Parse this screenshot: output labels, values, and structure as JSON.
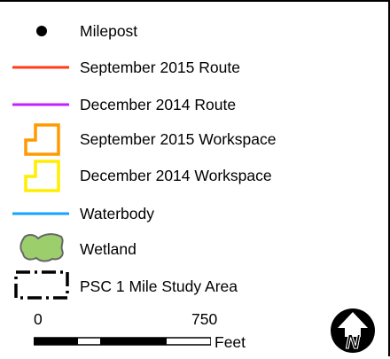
{
  "legend": {
    "items": [
      {
        "label": "Milepost",
        "symbol": "point",
        "color": "#000000"
      },
      {
        "label": "September 2015 Route",
        "symbol": "line",
        "color": "#ff3b1a"
      },
      {
        "label": "December 2014 Route",
        "symbol": "line",
        "color": "#c41fff"
      },
      {
        "label": "September 2015 Workspace",
        "symbol": "polygon-outline",
        "color": "#ff9a00"
      },
      {
        "label": "December 2014 Workspace",
        "symbol": "polygon-outline",
        "color": "#ffee00"
      },
      {
        "label": "Waterbody",
        "symbol": "line",
        "color": "#1aa0ff"
      },
      {
        "label": "Wetland",
        "symbol": "polygon-fill",
        "color": "#9ccf6c"
      },
      {
        "label": "PSC 1 Mile Study Area",
        "symbol": "dash-dot-outline",
        "color": "#000000"
      }
    ]
  },
  "scalebar": {
    "start_label": "0",
    "end_label": "750",
    "unit_label": "Feet"
  },
  "north_arrow": {
    "icon": "north-arrow-icon",
    "letter": "N"
  }
}
